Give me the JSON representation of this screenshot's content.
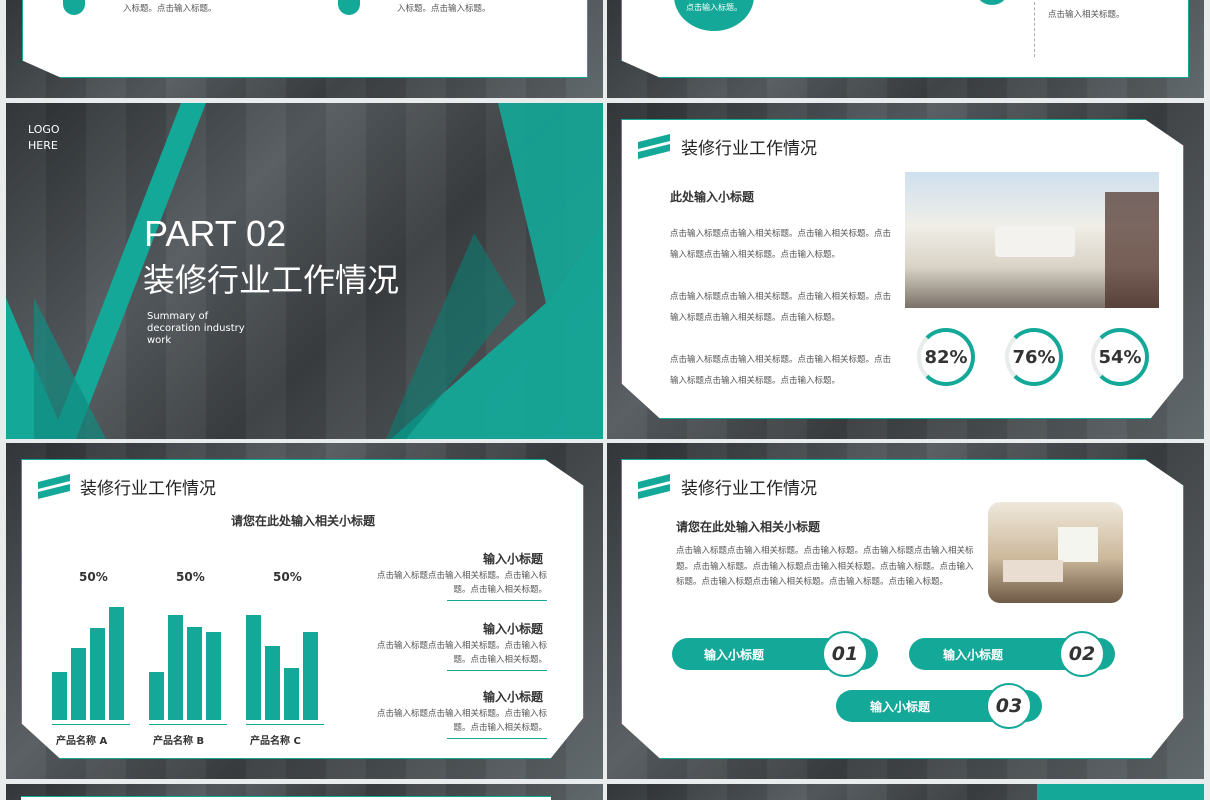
{
  "colors": {
    "accent": "#14a898"
  },
  "top_strip": {
    "left_texts": [
      "入标题。点击输入标题。",
      "入标题。点击输入标题。"
    ],
    "right_circle": "点击输入标题。",
    "right_texts": [
      "点击输入相关标题。"
    ]
  },
  "part_slide": {
    "logo": "LOGO\nHERE",
    "part": "PART 02",
    "title": "装修行业工作情况",
    "summary": "Summary of\ndecoration industry\nwork"
  },
  "stats_slide": {
    "title": "装修行业工作情况",
    "subtitle": "此处输入小标题",
    "paragraphs": [
      "点击输入标题点击输入相关标题。点击输入相关标题。点击输入标题点击输入相关标题。点击输入标题。",
      "点击输入标题点击输入相关标题。点击输入相关标题。点击输入标题点击输入相关标题。点击输入标题。",
      "点击输入标题点击输入相关标题。点击输入相关标题。点击输入标题点击输入相关标题。点击输入标题。"
    ],
    "percents": [
      "82%",
      "76%",
      "54%"
    ]
  },
  "chart_slide": {
    "title": "装修行业工作情况",
    "subtitle": "请您在此处输入相关小标题",
    "items": [
      {
        "title": "输入小标题",
        "text": "点击输入标题点击输入相关标题。点击输入标题。点击输入相关标题。"
      },
      {
        "title": "输入小标题",
        "text": "点击输入标题点击输入相关标题。点击输入标题。点击输入相关标题。"
      },
      {
        "title": "输入小标题",
        "text": "点击输入标题点击输入相关标题。点击输入标题。点击输入相关标题。"
      }
    ]
  },
  "chart_data": {
    "type": "bar",
    "groups": [
      {
        "name": "产品名称 A",
        "label": "50%",
        "values": [
          48,
          72,
          92,
          113
        ]
      },
      {
        "name": "产品名称 B",
        "label": "50%",
        "values": [
          48,
          105,
          93,
          88
        ]
      },
      {
        "name": "产品名称 C",
        "label": "50%",
        "values": [
          105,
          74,
          52,
          88
        ]
      }
    ]
  },
  "pill_slide": {
    "title": "装修行业工作情况",
    "subtitle": "请您在此处输入相关小标题",
    "paragraph": "点击输入标题点击输入相关标题。点击输入标题。点击输入标题点击输入相关标题。点击输入标题。点击输入标题点击输入相关标题。点击输入标题。点击输入标题。点击输入标题点击输入相关标题。点击输入标题。点击输入标题。",
    "pills": [
      {
        "label": "输入小标题",
        "num": "01"
      },
      {
        "label": "输入小标题",
        "num": "02"
      },
      {
        "label": "输入小标题",
        "num": "03"
      }
    ]
  }
}
